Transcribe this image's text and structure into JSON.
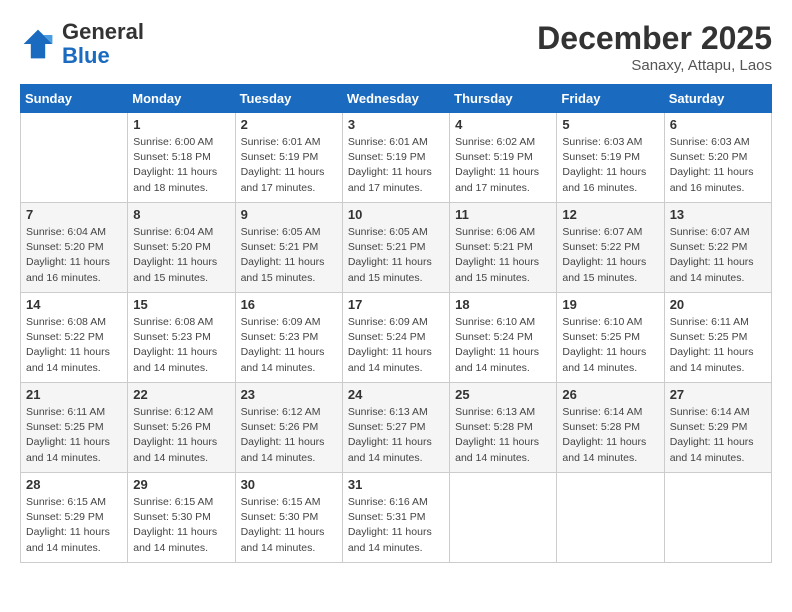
{
  "header": {
    "logo_line1": "General",
    "logo_line2": "Blue",
    "month_year": "December 2025",
    "location": "Sanaxy, Attapu, Laos"
  },
  "weekdays": [
    "Sunday",
    "Monday",
    "Tuesday",
    "Wednesday",
    "Thursday",
    "Friday",
    "Saturday"
  ],
  "weeks": [
    [
      {
        "day": "",
        "info": ""
      },
      {
        "day": "1",
        "info": "Sunrise: 6:00 AM\nSunset: 5:18 PM\nDaylight: 11 hours\nand 18 minutes."
      },
      {
        "day": "2",
        "info": "Sunrise: 6:01 AM\nSunset: 5:19 PM\nDaylight: 11 hours\nand 17 minutes."
      },
      {
        "day": "3",
        "info": "Sunrise: 6:01 AM\nSunset: 5:19 PM\nDaylight: 11 hours\nand 17 minutes."
      },
      {
        "day": "4",
        "info": "Sunrise: 6:02 AM\nSunset: 5:19 PM\nDaylight: 11 hours\nand 17 minutes."
      },
      {
        "day": "5",
        "info": "Sunrise: 6:03 AM\nSunset: 5:19 PM\nDaylight: 11 hours\nand 16 minutes."
      },
      {
        "day": "6",
        "info": "Sunrise: 6:03 AM\nSunset: 5:20 PM\nDaylight: 11 hours\nand 16 minutes."
      }
    ],
    [
      {
        "day": "7",
        "info": "Sunrise: 6:04 AM\nSunset: 5:20 PM\nDaylight: 11 hours\nand 16 minutes."
      },
      {
        "day": "8",
        "info": "Sunrise: 6:04 AM\nSunset: 5:20 PM\nDaylight: 11 hours\nand 15 minutes."
      },
      {
        "day": "9",
        "info": "Sunrise: 6:05 AM\nSunset: 5:21 PM\nDaylight: 11 hours\nand 15 minutes."
      },
      {
        "day": "10",
        "info": "Sunrise: 6:05 AM\nSunset: 5:21 PM\nDaylight: 11 hours\nand 15 minutes."
      },
      {
        "day": "11",
        "info": "Sunrise: 6:06 AM\nSunset: 5:21 PM\nDaylight: 11 hours\nand 15 minutes."
      },
      {
        "day": "12",
        "info": "Sunrise: 6:07 AM\nSunset: 5:22 PM\nDaylight: 11 hours\nand 15 minutes."
      },
      {
        "day": "13",
        "info": "Sunrise: 6:07 AM\nSunset: 5:22 PM\nDaylight: 11 hours\nand 14 minutes."
      }
    ],
    [
      {
        "day": "14",
        "info": "Sunrise: 6:08 AM\nSunset: 5:22 PM\nDaylight: 11 hours\nand 14 minutes."
      },
      {
        "day": "15",
        "info": "Sunrise: 6:08 AM\nSunset: 5:23 PM\nDaylight: 11 hours\nand 14 minutes."
      },
      {
        "day": "16",
        "info": "Sunrise: 6:09 AM\nSunset: 5:23 PM\nDaylight: 11 hours\nand 14 minutes."
      },
      {
        "day": "17",
        "info": "Sunrise: 6:09 AM\nSunset: 5:24 PM\nDaylight: 11 hours\nand 14 minutes."
      },
      {
        "day": "18",
        "info": "Sunrise: 6:10 AM\nSunset: 5:24 PM\nDaylight: 11 hours\nand 14 minutes."
      },
      {
        "day": "19",
        "info": "Sunrise: 6:10 AM\nSunset: 5:25 PM\nDaylight: 11 hours\nand 14 minutes."
      },
      {
        "day": "20",
        "info": "Sunrise: 6:11 AM\nSunset: 5:25 PM\nDaylight: 11 hours\nand 14 minutes."
      }
    ],
    [
      {
        "day": "21",
        "info": "Sunrise: 6:11 AM\nSunset: 5:25 PM\nDaylight: 11 hours\nand 14 minutes."
      },
      {
        "day": "22",
        "info": "Sunrise: 6:12 AM\nSunset: 5:26 PM\nDaylight: 11 hours\nand 14 minutes."
      },
      {
        "day": "23",
        "info": "Sunrise: 6:12 AM\nSunset: 5:26 PM\nDaylight: 11 hours\nand 14 minutes."
      },
      {
        "day": "24",
        "info": "Sunrise: 6:13 AM\nSunset: 5:27 PM\nDaylight: 11 hours\nand 14 minutes."
      },
      {
        "day": "25",
        "info": "Sunrise: 6:13 AM\nSunset: 5:28 PM\nDaylight: 11 hours\nand 14 minutes."
      },
      {
        "day": "26",
        "info": "Sunrise: 6:14 AM\nSunset: 5:28 PM\nDaylight: 11 hours\nand 14 minutes."
      },
      {
        "day": "27",
        "info": "Sunrise: 6:14 AM\nSunset: 5:29 PM\nDaylight: 11 hours\nand 14 minutes."
      }
    ],
    [
      {
        "day": "28",
        "info": "Sunrise: 6:15 AM\nSunset: 5:29 PM\nDaylight: 11 hours\nand 14 minutes."
      },
      {
        "day": "29",
        "info": "Sunrise: 6:15 AM\nSunset: 5:30 PM\nDaylight: 11 hours\nand 14 minutes."
      },
      {
        "day": "30",
        "info": "Sunrise: 6:15 AM\nSunset: 5:30 PM\nDaylight: 11 hours\nand 14 minutes."
      },
      {
        "day": "31",
        "info": "Sunrise: 6:16 AM\nSunset: 5:31 PM\nDaylight: 11 hours\nand 14 minutes."
      },
      {
        "day": "",
        "info": ""
      },
      {
        "day": "",
        "info": ""
      },
      {
        "day": "",
        "info": ""
      }
    ]
  ]
}
